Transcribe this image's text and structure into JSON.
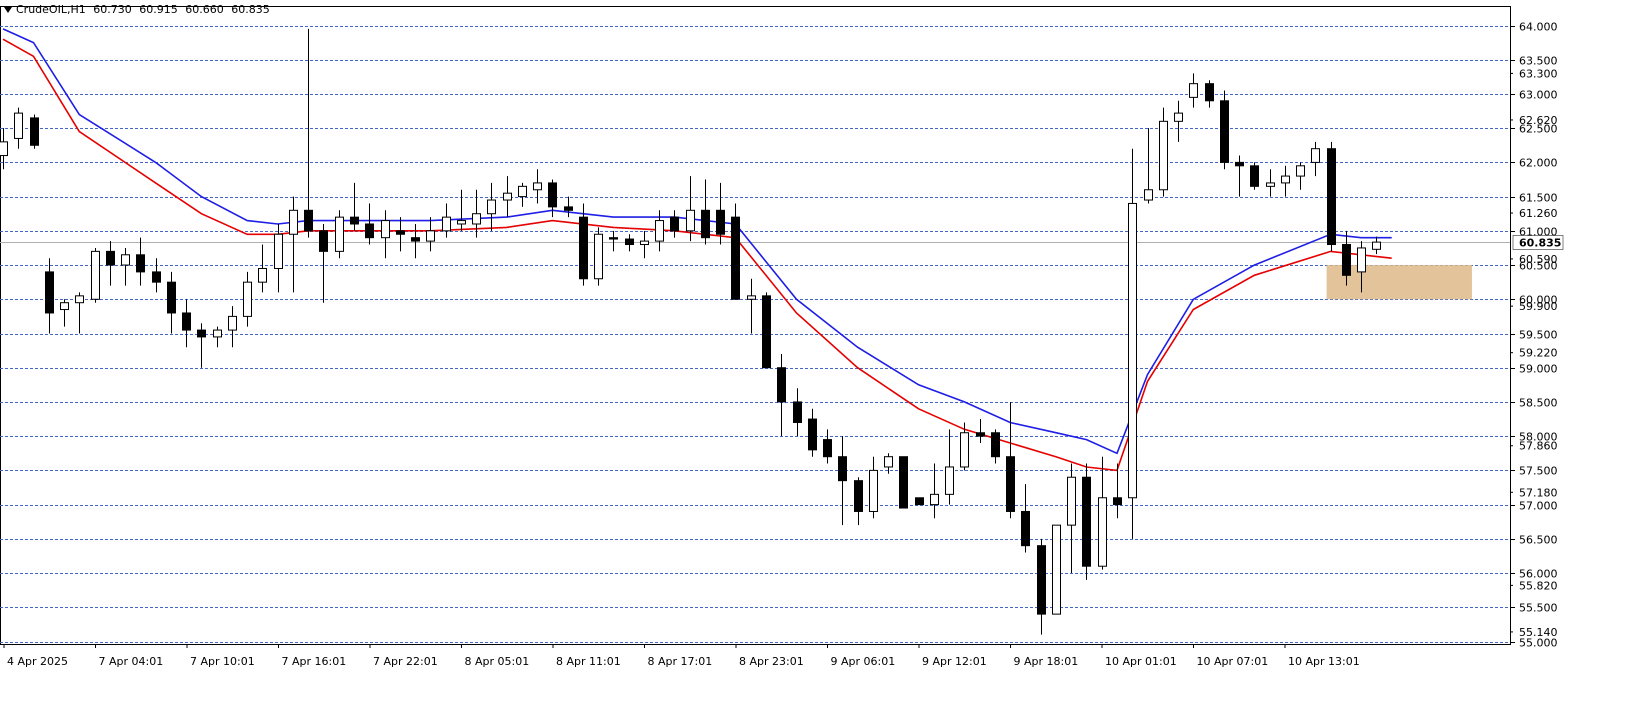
{
  "header": {
    "symbol": "CrudeOIL,H1",
    "open": "60.730",
    "high": "60.915",
    "low": "60.660",
    "close": "60.835"
  },
  "colors": {
    "background": "#ffffff",
    "grid": "#4466c4",
    "candle_bull_body": "#ffffff",
    "candle_bear_body": "#000000",
    "candle_outline": "#000000",
    "ma_fast": "#1e1ee6",
    "ma_slow": "#e60000",
    "zone": "#deb887",
    "axis_label": "#000000",
    "price_badge": "#4a6fd0"
  },
  "chart_data": {
    "type": "candlestick",
    "ylim": [
      55.0,
      64.0
    ],
    "grid_levels": [
      "64.000",
      "63.500",
      "63.000",
      "62.500",
      "62.000",
      "61.500",
      "61.000",
      "60.500",
      "60.000",
      "59.500",
      "59.000",
      "58.500",
      "58.000",
      "57.500",
      "57.000",
      "56.500",
      "56.000",
      "55.500",
      "55.000"
    ],
    "minor_labels": [
      "63.300",
      "62.620",
      "61.260",
      "60.590",
      "59.900",
      "59.220",
      "57.860",
      "57.180",
      "55.820",
      "55.140"
    ],
    "current_price": "60.835",
    "x_labels": [
      "4 Apr 2025",
      "7 Apr 04:01",
      "7 Apr 10:01",
      "7 Apr 16:01",
      "7 Apr 22:01",
      "8 Apr 05:01",
      "8 Apr 11:01",
      "8 Apr 17:01",
      "8 Apr 23:01",
      "9 Apr 06:01",
      "9 Apr 12:01",
      "9 Apr 18:01",
      "10 Apr 01:01",
      "10 Apr 07:01",
      "10 Apr 13:01"
    ],
    "candles": [
      [
        62.1,
        62.5,
        61.9,
        62.3
      ],
      [
        62.35,
        62.8,
        62.2,
        62.72
      ],
      [
        62.65,
        62.7,
        62.2,
        62.25
      ],
      [
        60.4,
        60.6,
        59.5,
        59.8
      ],
      [
        59.85,
        60.0,
        59.6,
        59.95
      ],
      [
        59.95,
        60.1,
        59.5,
        60.05
      ],
      [
        60.0,
        60.75,
        59.95,
        60.7
      ],
      [
        60.7,
        60.85,
        60.2,
        60.5
      ],
      [
        60.5,
        60.75,
        60.2,
        60.65
      ],
      [
        60.65,
        60.9,
        60.2,
        60.4
      ],
      [
        60.4,
        60.6,
        60.1,
        60.25
      ],
      [
        60.25,
        60.4,
        59.5,
        59.8
      ],
      [
        59.8,
        60.0,
        59.3,
        59.55
      ],
      [
        59.55,
        59.65,
        59.0,
        59.45
      ],
      [
        59.45,
        59.6,
        59.3,
        59.55
      ],
      [
        59.55,
        59.9,
        59.3,
        59.75
      ],
      [
        59.75,
        60.4,
        59.6,
        60.25
      ],
      [
        60.25,
        60.8,
        60.1,
        60.45
      ],
      [
        60.45,
        61.1,
        60.1,
        60.95
      ],
      [
        60.95,
        61.5,
        60.1,
        61.3
      ],
      [
        61.3,
        63.95,
        60.9,
        61.0
      ],
      [
        61.0,
        61.1,
        59.95,
        60.7
      ],
      [
        60.7,
        61.3,
        60.6,
        61.2
      ],
      [
        61.2,
        61.7,
        61.0,
        61.1
      ],
      [
        61.1,
        61.4,
        60.8,
        60.9
      ],
      [
        60.9,
        61.3,
        60.6,
        61.15
      ],
      [
        61.0,
        61.2,
        60.7,
        60.95
      ],
      [
        60.9,
        61.1,
        60.6,
        60.85
      ],
      [
        60.85,
        61.2,
        60.7,
        61.0
      ],
      [
        61.0,
        61.4,
        60.9,
        61.2
      ],
      [
        61.1,
        61.6,
        61.0,
        61.15
      ],
      [
        61.1,
        61.6,
        60.9,
        61.25
      ],
      [
        61.25,
        61.7,
        61.0,
        61.45
      ],
      [
        61.45,
        61.8,
        61.2,
        61.55
      ],
      [
        61.5,
        61.7,
        61.35,
        61.65
      ],
      [
        61.6,
        61.9,
        61.4,
        61.7
      ],
      [
        61.7,
        61.75,
        61.2,
        61.35
      ],
      [
        61.35,
        61.5,
        61.2,
        61.3
      ],
      [
        61.2,
        61.4,
        60.2,
        60.3
      ],
      [
        60.3,
        61.05,
        60.2,
        60.95
      ],
      [
        60.9,
        61.0,
        60.7,
        60.88
      ],
      [
        60.88,
        60.95,
        60.7,
        60.8
      ],
      [
        60.8,
        61.0,
        60.6,
        60.85
      ],
      [
        60.85,
        61.3,
        60.7,
        61.15
      ],
      [
        61.2,
        61.3,
        60.9,
        61.0
      ],
      [
        61.0,
        61.8,
        60.85,
        61.3
      ],
      [
        61.3,
        61.75,
        60.8,
        60.9
      ],
      [
        61.3,
        61.7,
        60.8,
        60.95
      ],
      [
        61.2,
        61.4,
        60.4,
        60.0
      ],
      [
        60.0,
        60.3,
        59.5,
        60.05
      ],
      [
        60.05,
        60.1,
        59.0,
        59.0
      ],
      [
        59.0,
        59.2,
        58.0,
        58.5
      ],
      [
        58.5,
        58.7,
        58.0,
        58.2
      ],
      [
        58.25,
        58.4,
        57.7,
        57.8
      ],
      [
        57.95,
        58.1,
        57.6,
        57.7
      ],
      [
        57.7,
        58.0,
        56.7,
        57.35
      ],
      [
        57.35,
        57.4,
        56.7,
        56.9
      ],
      [
        56.9,
        57.7,
        56.8,
        57.5
      ],
      [
        57.55,
        57.75,
        57.45,
        57.7
      ],
      [
        57.7,
        57.7,
        56.95,
        56.95
      ],
      [
        57.1,
        57.1,
        57.0,
        57.0
      ],
      [
        57.0,
        57.6,
        56.8,
        57.15
      ],
      [
        57.15,
        58.1,
        57.0,
        57.55
      ],
      [
        57.55,
        58.2,
        57.5,
        58.05
      ],
      [
        58.05,
        58.25,
        57.9,
        58.0
      ],
      [
        58.05,
        58.1,
        57.6,
        57.7
      ],
      [
        57.7,
        58.5,
        56.8,
        56.9
      ],
      [
        56.9,
        57.3,
        56.3,
        56.4
      ],
      [
        56.4,
        56.5,
        55.1,
        55.4
      ],
      [
        55.4,
        56.7,
        55.4,
        56.7
      ],
      [
        56.7,
        57.6,
        56.0,
        57.4
      ],
      [
        57.4,
        57.6,
        55.9,
        56.1
      ],
      [
        56.1,
        57.7,
        56.05,
        57.1
      ],
      [
        57.1,
        57.6,
        56.8,
        57.0
      ],
      [
        57.1,
        62.2,
        56.5,
        61.4
      ],
      [
        61.45,
        62.5,
        61.4,
        61.6
      ],
      [
        61.6,
        62.8,
        61.5,
        62.6
      ],
      [
        62.6,
        62.9,
        62.3,
        62.72
      ],
      [
        62.95,
        63.3,
        62.8,
        63.15
      ],
      [
        63.15,
        63.2,
        62.8,
        62.9
      ],
      [
        62.9,
        63.05,
        61.9,
        62.0
      ],
      [
        62.0,
        62.1,
        61.5,
        61.95
      ],
      [
        61.95,
        62.0,
        61.6,
        61.65
      ],
      [
        61.65,
        61.9,
        61.5,
        61.7
      ],
      [
        61.7,
        61.95,
        61.5,
        61.8
      ],
      [
        61.8,
        62.0,
        61.6,
        61.95
      ],
      [
        62.0,
        62.3,
        61.8,
        62.2
      ],
      [
        62.2,
        62.3,
        60.7,
        60.8
      ],
      [
        60.8,
        61.0,
        60.2,
        60.35
      ],
      [
        60.4,
        60.85,
        60.1,
        60.75
      ],
      [
        60.73,
        60.915,
        60.66,
        60.835
      ]
    ],
    "moving_averages": [
      {
        "color_key": "ma_fast",
        "values": [
          [
            0,
            63.95
          ],
          [
            2,
            63.75
          ],
          [
            5,
            62.7
          ],
          [
            10,
            62.0
          ],
          [
            13,
            61.5
          ],
          [
            16,
            61.15
          ],
          [
            18,
            61.1
          ],
          [
            20,
            61.15
          ],
          [
            28,
            61.15
          ],
          [
            33,
            61.2
          ],
          [
            36,
            61.3
          ],
          [
            40,
            61.2
          ],
          [
            44,
            61.2
          ],
          [
            48,
            61.1
          ],
          [
            52,
            60.0
          ],
          [
            56,
            59.3
          ],
          [
            60,
            58.75
          ],
          [
            63,
            58.5
          ],
          [
            66,
            58.2
          ],
          [
            69,
            58.05
          ],
          [
            71,
            57.95
          ],
          [
            73,
            57.75
          ],
          [
            75,
            58.9
          ],
          [
            78,
            60.0
          ],
          [
            82,
            60.5
          ],
          [
            87,
            60.95
          ],
          [
            89,
            60.9
          ],
          [
            91,
            60.9
          ]
        ]
      },
      {
        "color_key": "ma_slow",
        "values": [
          [
            0,
            63.8
          ],
          [
            2,
            63.55
          ],
          [
            5,
            62.45
          ],
          [
            10,
            61.7
          ],
          [
            13,
            61.25
          ],
          [
            16,
            60.95
          ],
          [
            18,
            60.95
          ],
          [
            20,
            61.0
          ],
          [
            28,
            61.0
          ],
          [
            33,
            61.05
          ],
          [
            36,
            61.15
          ],
          [
            40,
            61.05
          ],
          [
            44,
            61.0
          ],
          [
            48,
            60.9
          ],
          [
            52,
            59.8
          ],
          [
            56,
            59.0
          ],
          [
            60,
            58.4
          ],
          [
            63,
            58.1
          ],
          [
            66,
            57.9
          ],
          [
            69,
            57.7
          ],
          [
            71,
            57.55
          ],
          [
            73,
            57.5
          ],
          [
            75,
            58.8
          ],
          [
            78,
            59.85
          ],
          [
            82,
            60.35
          ],
          [
            87,
            60.7
          ],
          [
            89,
            60.65
          ],
          [
            91,
            60.6
          ]
        ]
      }
    ],
    "zone": {
      "from_index": 87,
      "to_index": 96,
      "price_low": 60.0,
      "price_high": 60.5
    }
  }
}
